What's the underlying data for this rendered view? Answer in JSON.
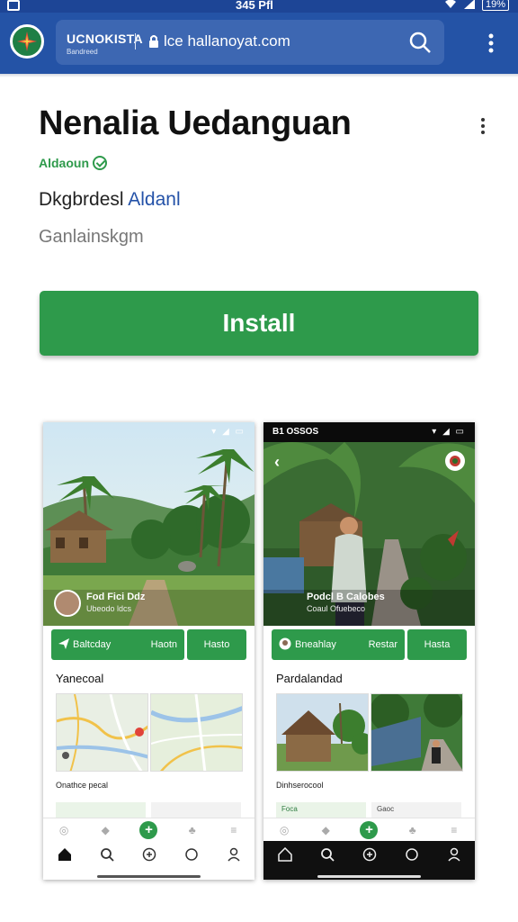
{
  "status_bar": {
    "time": "345 Pfl",
    "battery": "19%"
  },
  "browser": {
    "brand_name": "UCNOKISTA",
    "brand_tagline": "Bandreed",
    "url": "lce hallanoyat.com"
  },
  "app": {
    "title": "Nenalia Uedanguan",
    "developer": "Aldaoun",
    "category_prefix": "Dkgbrdesl",
    "category_link": "Aldanl",
    "subcategory": "Ganlainskgm",
    "install_label": "Install"
  },
  "screenshots": [
    {
      "status_time": "",
      "post_title": "Fod Fici Ddz",
      "post_sub": "Ubeodo ldcs",
      "action_primary_left": "Baltcday",
      "action_primary_right": "Haotn",
      "action_secondary": "Hasto",
      "section_title": "Yanecoal",
      "caption": "Onathce pecal",
      "chip_left": "",
      "chip_right": ""
    },
    {
      "status_time": "B1 OSSOS",
      "post_title": "Podcl B Calobes",
      "post_sub": "Coaul Ofuebeco",
      "action_primary_left": "Bneahlay",
      "action_primary_right": "Restar",
      "action_secondary": "Hasta",
      "section_title": "Pardalandad",
      "caption": "Dinhserocool",
      "chip_left": "Foca",
      "chip_right": "Gaoc"
    }
  ],
  "colors": {
    "header_blue": "#2453a6",
    "status_blue": "#1d4596",
    "install_green": "#2e9a4b",
    "link_blue": "#2452a8"
  },
  "icons": [
    "search-icon",
    "menu-dots-icon",
    "lock-icon",
    "verified-icon",
    "home-icon",
    "plus-icon",
    "profile-icon"
  ]
}
